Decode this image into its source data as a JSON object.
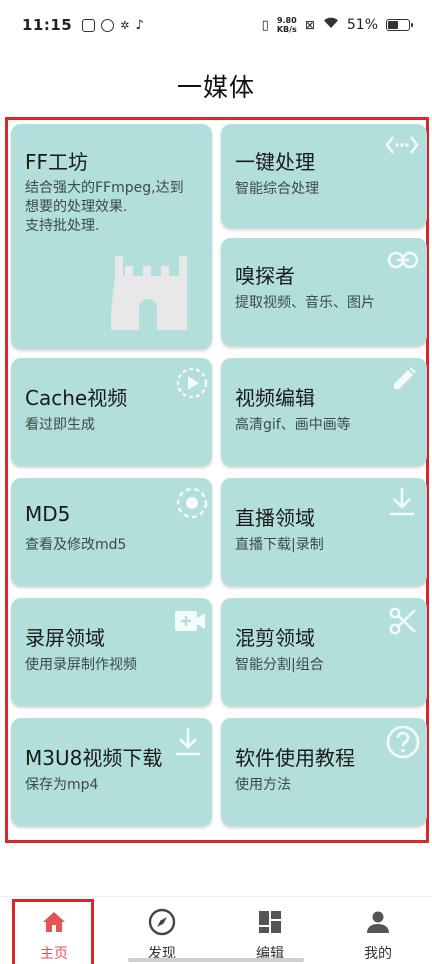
{
  "status_bar": {
    "time": "11:15",
    "net_speed_value": "9.80",
    "net_speed_unit": "KB/s",
    "battery": "51%",
    "battery_level": 0.51
  },
  "page": {
    "title": "一媒体"
  },
  "cards": {
    "ff": {
      "title": "FF工坊",
      "desc_line1": "结合强大的FFmpeg,达到",
      "desc_line2": "想要的处理效果.",
      "desc_line3": "支持批处理.",
      "icon": "castle-icon"
    },
    "onekey": {
      "title": "一键处理",
      "desc": "智能综合处理",
      "icon": "code-icon"
    },
    "sniffer": {
      "title": "嗅探者",
      "desc": "提取视频、音乐、图片",
      "icon": "link-icon"
    },
    "cache": {
      "title": "Cache视频",
      "desc": "看过即生成",
      "icon": "play-circle-icon"
    },
    "edit": {
      "title": "视频编辑",
      "desc": "高清gif、画中画等",
      "icon": "pencil-icon"
    },
    "md5": {
      "title": "MD5",
      "desc": "查看及修改md5",
      "icon": "dashed-circle-icon"
    },
    "live": {
      "title": "直播领域",
      "desc": "直播下载|录制",
      "icon": "download-icon"
    },
    "record": {
      "title": "录屏领域",
      "desc": "使用录屏制作视频",
      "icon": "video-add-icon"
    },
    "mix": {
      "title": "混剪领域",
      "desc": "智能分割|组合",
      "icon": "scissors-icon"
    },
    "m3u8": {
      "title": "M3U8视频下载",
      "desc": "保存为mp4",
      "icon": "download-icon"
    },
    "tutorial": {
      "title": "软件使用教程",
      "desc": "使用方法",
      "icon": "help-circle-icon"
    }
  },
  "bottom_nav": [
    {
      "label": "主页",
      "icon": "home-icon",
      "active": true
    },
    {
      "label": "发现",
      "icon": "compass-icon",
      "active": false
    },
    {
      "label": "编辑",
      "icon": "dashboard-icon",
      "active": false
    },
    {
      "label": "我的",
      "icon": "person-icon",
      "active": false
    }
  ],
  "colors": {
    "card_bg": "#b2dfdb",
    "accent_red": "#d8282c",
    "nav_active": "#e05555",
    "icon_white": "#f4fbfa"
  }
}
